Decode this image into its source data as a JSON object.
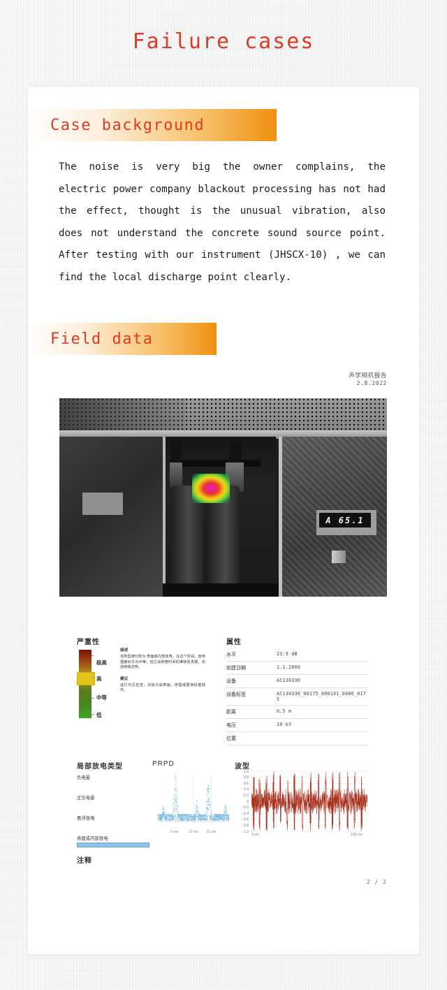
{
  "page": {
    "title": "Failure cases",
    "title_color": "#e03a22",
    "accent_color": "#ef8f10"
  },
  "sections": {
    "case_background": {
      "heading": "Case background",
      "body": "The noise is very big the owner complains, the electric power company blackout processing has not had the effect, thought is the unusual vibration, also does not understand the concrete sound source point. After testing with our instrument (JHSCX-10) , we can find the local discharge point clearly."
    },
    "field_data": {
      "heading": "Field data"
    }
  },
  "report": {
    "header_title": "声学相机报告",
    "header_date": "2.8.2022",
    "page_number": "2 / 2",
    "photo": {
      "display_reading": "A 65.1",
      "hotspot_label": "acoustic-hotspot"
    },
    "severity": {
      "title": "严重性",
      "levels": [
        "极高",
        "高",
        "中等",
        "低"
      ],
      "active_level": "高",
      "description_heading": "描述",
      "description_text": "该类型被归类为 表面或内部放电。在这个阶段，放电强度似乎为中等，但它会随着时间的推移而发展，完成绝缘击穿。",
      "advice_heading": "建议",
      "advice_text": "进行可见检查，清除污染表面，修理或更换损害部件。"
    },
    "attributes": {
      "title": "属性",
      "rows": [
        {
          "key": "水平",
          "value": "23.9 dB"
        },
        {
          "key": "创建日期",
          "value": "1.1.2000"
        },
        {
          "key": "设备",
          "value": "AC130330"
        },
        {
          "key": "设备标签",
          "value": "AC130330_00175_000101_0806_0175"
        },
        {
          "key": "距离",
          "value": "0.5 m"
        },
        {
          "key": "电压",
          "value": "10 kV"
        },
        {
          "key": "位置",
          "value": ""
        }
      ]
    },
    "pd_type": {
      "title": "局部放电类型",
      "items": [
        {
          "label": "负电晕",
          "active": false
        },
        {
          "label": "正负电晕",
          "active": false
        },
        {
          "label": "悬浮放电",
          "active": false
        },
        {
          "label": "表面或内部放电",
          "active": true
        }
      ]
    },
    "notes": {
      "title": "注释",
      "text": ""
    }
  },
  "chart_data": [
    {
      "type": "scatter",
      "title": "PRPD",
      "xlabel": "",
      "ylabel": "",
      "xlim": [
        0,
        20
      ],
      "ylim": [
        0,
        1
      ],
      "xticks": [
        "5 ms",
        "10 ms",
        "15 ms"
      ],
      "xtick_values": [
        5,
        10,
        15
      ],
      "grid": false,
      "point_color": "#72b6db",
      "description": "Phase-resolved partial discharge scatter cloud with dense noise floor and three pulse clusters peaking near 5 ms, 11 ms and 14 ms.",
      "clusters": [
        {
          "center_ms": 5.0,
          "peak_amplitude": 0.95,
          "width_ms": 0.9
        },
        {
          "center_ms": 11.0,
          "peak_amplitude": 0.42,
          "width_ms": 0.7
        },
        {
          "center_ms": 14.2,
          "peak_amplitude": 0.78,
          "width_ms": 0.9
        },
        {
          "center_ms": 19.0,
          "peak_amplitude": 0.35,
          "width_ms": 0.6
        },
        {
          "center_ms": 1.6,
          "peak_amplitude": 0.3,
          "width_ms": 0.6
        }
      ],
      "noise_floor": 0.14
    },
    {
      "type": "line",
      "title": "波型",
      "xlabel": "",
      "ylabel": "",
      "xlim": [
        0,
        100
      ],
      "ylim": [
        -1.0,
        1.0
      ],
      "yticks": [
        1.0,
        0.8,
        0.6,
        0.4,
        0.2,
        0,
        -0.2,
        -0.4,
        -0.6,
        -0.8,
        -1.0
      ],
      "ytick_labels": [
        "1.0",
        "0.8",
        "0.6",
        "0.4",
        "0.2",
        "0",
        "-0.2",
        "-0.4",
        "-0.6",
        "-0.8",
        "-1.0"
      ],
      "xticks": [
        "0 ms",
        "100 ms"
      ],
      "xtick_values": [
        0,
        100
      ],
      "grid": true,
      "line_color": "#a8321e",
      "description": "Dense acoustic time-domain waveform over 100 ms, baseline noise band roughly ±0.35 with periodic discharge spikes reaching ±1.0.",
      "noise_band": 0.35,
      "spike_amplitude": 1.0,
      "spike_times_ms": [
        2,
        7,
        13,
        19,
        25,
        31,
        37,
        44,
        51,
        58,
        64,
        70,
        76,
        83,
        89,
        95
      ]
    }
  ]
}
